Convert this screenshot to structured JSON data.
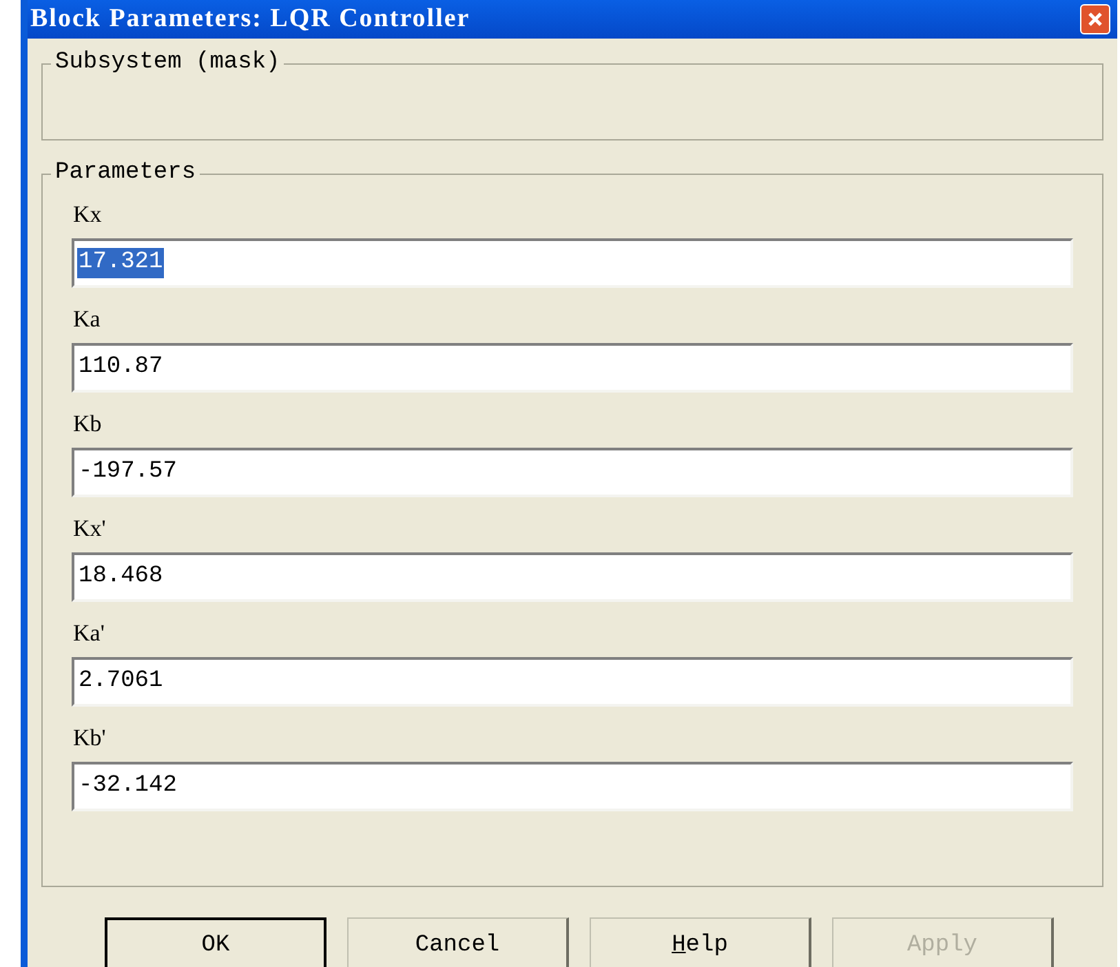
{
  "window": {
    "title": "Block Parameters: LQR Controller"
  },
  "subsystem_group": {
    "title": "Subsystem (mask)"
  },
  "parameters_group": {
    "title": "Parameters",
    "fields": [
      {
        "label": "Kx",
        "value": "17.321",
        "selected": true
      },
      {
        "label": "Ka",
        "value": "110.87",
        "selected": false
      },
      {
        "label": "Kb",
        "value": "-197.57",
        "selected": false
      },
      {
        "label": "Kx'",
        "value": "18.468",
        "selected": false
      },
      {
        "label": "Ka'",
        "value": "2.7061",
        "selected": false
      },
      {
        "label": "Kb'",
        "value": "-32.142",
        "selected": false
      }
    ]
  },
  "buttons": [
    {
      "label": "OK",
      "default": true,
      "disabled": false,
      "mnemonic_first": false
    },
    {
      "label": "Cancel",
      "default": false,
      "disabled": false,
      "mnemonic_first": false
    },
    {
      "label": "Help",
      "default": false,
      "disabled": false,
      "mnemonic_first": true
    },
    {
      "label": "Apply",
      "default": false,
      "disabled": true,
      "mnemonic_first": false
    }
  ]
}
